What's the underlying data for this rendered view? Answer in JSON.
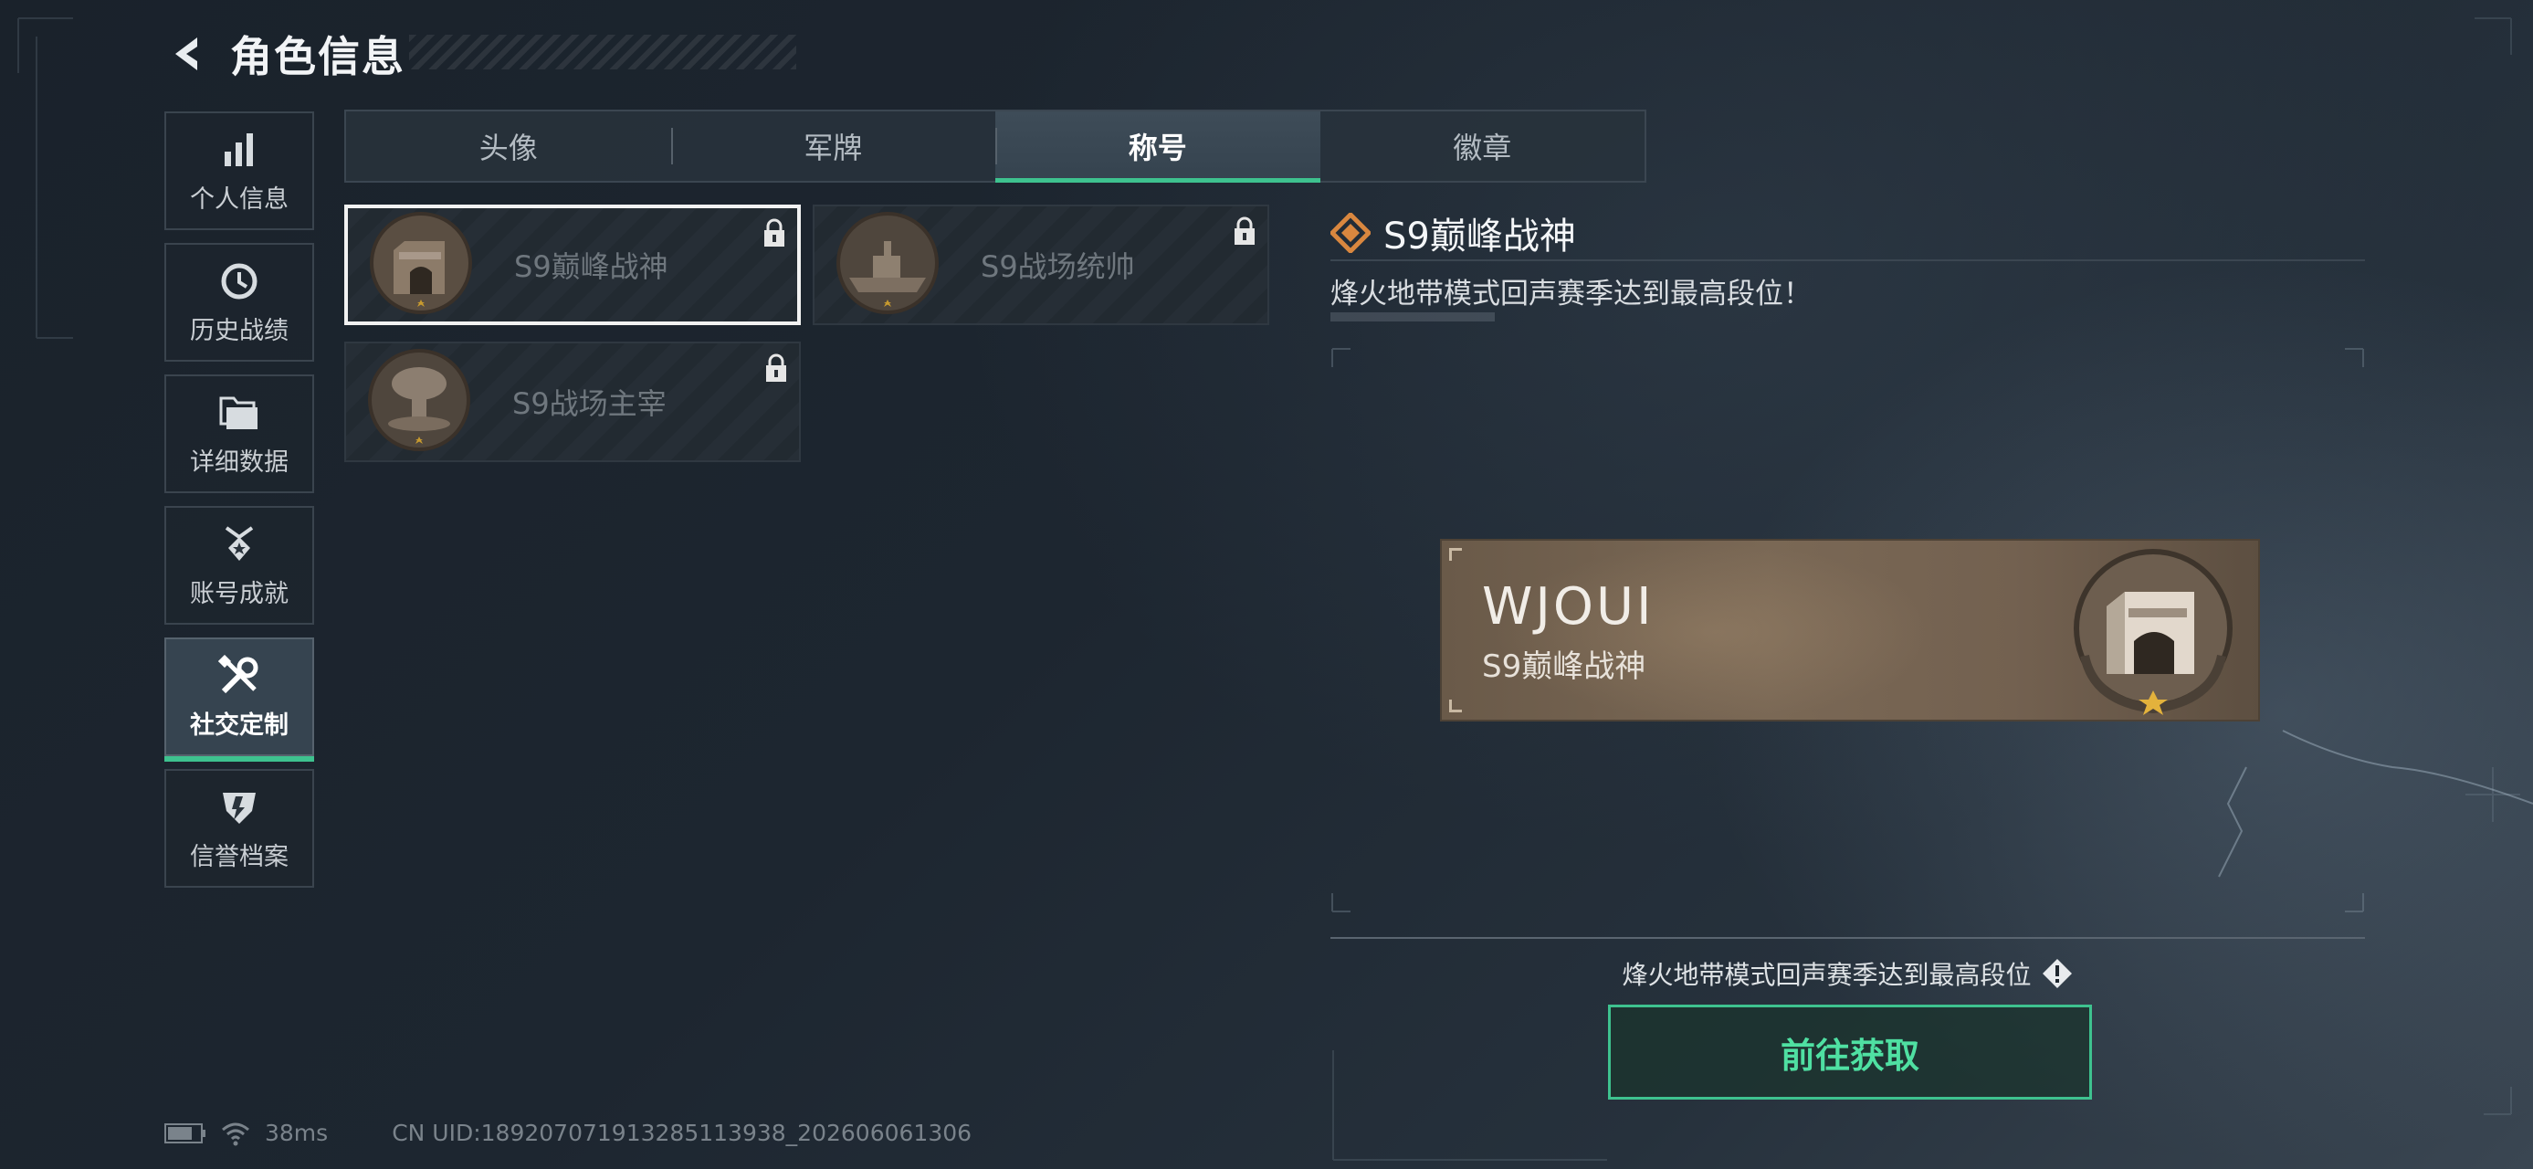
{
  "header": {
    "title": "角色信息"
  },
  "side_nav": [
    {
      "label": "个人信息",
      "icon": "bar-chart-icon",
      "active": false
    },
    {
      "label": "历史战绩",
      "icon": "clock-history-icon",
      "active": false
    },
    {
      "label": "详细数据",
      "icon": "folder-icon",
      "active": false
    },
    {
      "label": "账号成就",
      "icon": "achievement-medal-icon",
      "active": false
    },
    {
      "label": "社交定制",
      "icon": "tools-icon",
      "active": true
    },
    {
      "label": "信誉档案",
      "icon": "credit-shield-icon",
      "active": false
    }
  ],
  "tabs": [
    {
      "label": "头像",
      "active": false
    },
    {
      "label": "军牌",
      "active": false
    },
    {
      "label": "称号",
      "active": true
    },
    {
      "label": "徽章",
      "active": false
    }
  ],
  "title_cards": [
    {
      "name": "S9巅峰战神",
      "emblem": "fortress-emblem-icon",
      "locked": true,
      "selected": true
    },
    {
      "name": "S9战场统帅",
      "emblem": "warship-emblem-icon",
      "locked": true,
      "selected": false
    },
    {
      "name": "S9战场主宰",
      "emblem": "mushroom-cloud-emblem-icon",
      "locked": true,
      "selected": false
    }
  ],
  "detail": {
    "title": "S9巅峰战神",
    "description": "烽火地带模式回声赛季达到最高段位！",
    "preview": {
      "player_name": "WJOUI",
      "title": "S9巅峰战神"
    },
    "obtain_hint": "烽火地带模式回声赛季达到最高段位",
    "obtain_button": "前往获取"
  },
  "colors": {
    "accent": "#3ec28f",
    "title_icon": "#d9873f"
  },
  "status_bar": {
    "ping": "38ms",
    "uid": "CN UID:18920707191328511393​8_202606061306"
  }
}
